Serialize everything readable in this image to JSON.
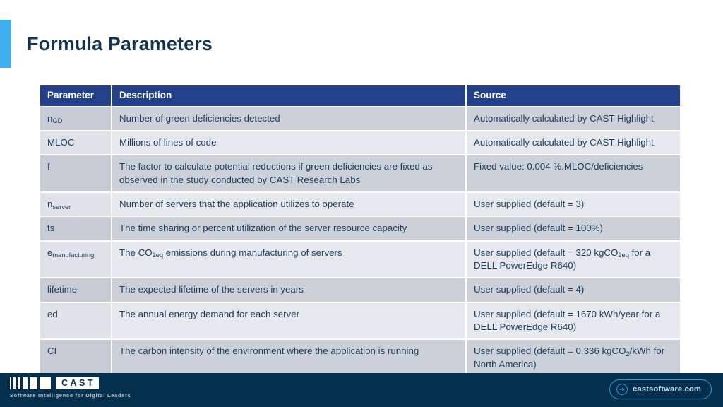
{
  "slide": {
    "title": "Formula Parameters",
    "accent_color": "#3dafee",
    "title_color": "#12354f"
  },
  "table": {
    "header_bg": "#23418a",
    "columns": [
      "Parameter",
      "Description",
      "Source"
    ],
    "rows": [
      {
        "parameter": "n",
        "parameter_sub": "GD",
        "description": "Number of green deficiencies detected",
        "source": "Automatically calculated by CAST Highlight"
      },
      {
        "parameter": "MLOC",
        "parameter_sub": "",
        "description": "Millions of lines of code",
        "source": "Automatically calculated by CAST Highlight"
      },
      {
        "parameter": "f",
        "parameter_sub": "",
        "description": "The factor to calculate potential reductions if green deficiencies are fixed as observed in the study conducted by CAST Research Labs",
        "source": "Fixed value: 0.004 %.MLOC/deficiencies"
      },
      {
        "parameter": "n",
        "parameter_sub": "server",
        "description": "Number of servers that the application utilizes to operate",
        "source": "User supplied (default = 3)"
      },
      {
        "parameter": "ts",
        "parameter_sub": "",
        "description": "The time sharing or percent utilization of the server resource capacity",
        "source": "User supplied (default = 100%)"
      },
      {
        "parameter": "e",
        "parameter_sub": "manufacturing",
        "description_pre": "The CO",
        "description_sub": "2eq",
        "description_post": " emissions during manufacturing of servers",
        "source_pre": "User supplied (default = 320 kgCO",
        "source_sub": "2eq",
        "source_post": " for a DELL PowerEdge R640)"
      },
      {
        "parameter": "lifetime",
        "parameter_sub": "",
        "description": "The expected lifetime of the servers in years",
        "source": "User supplied (default = 4)"
      },
      {
        "parameter": "ed",
        "parameter_sub": "",
        "description": "The annual energy demand for each server",
        "source": "User supplied (default = 1670 kWh/year for a DELL PowerEdge R640)"
      },
      {
        "parameter": "CI",
        "parameter_sub": "",
        "description": "The carbon intensity of the environment where the application is running",
        "source_pre": "User supplied (default = 0.336 kgCO",
        "source_sub": "2",
        "source_post": "/kWh for North America)"
      }
    ]
  },
  "footer": {
    "bg_color": "#04304e",
    "logo_word": "CAST",
    "tagline": "Software Intelligence for Digital Leaders",
    "cta_label": "castsoftware.com",
    "cta_icon": "arrow-right-circle-icon",
    "cta_color": "#2f9bd8"
  }
}
